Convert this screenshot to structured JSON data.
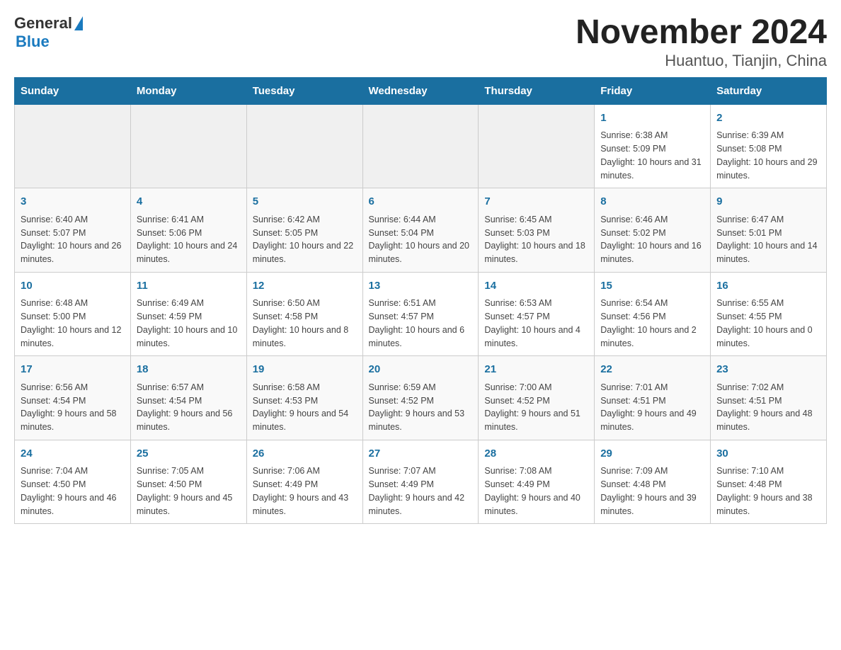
{
  "header": {
    "logo": {
      "text_general": "General",
      "triangle": "▶",
      "text_blue": "Blue"
    },
    "title": "November 2024",
    "subtitle": "Huantuo, Tianjin, China"
  },
  "days_of_week": [
    "Sunday",
    "Monday",
    "Tuesday",
    "Wednesday",
    "Thursday",
    "Friday",
    "Saturday"
  ],
  "weeks": [
    {
      "cells": [
        {
          "day": "",
          "info": ""
        },
        {
          "day": "",
          "info": ""
        },
        {
          "day": "",
          "info": ""
        },
        {
          "day": "",
          "info": ""
        },
        {
          "day": "",
          "info": ""
        },
        {
          "day": "1",
          "info": "Sunrise: 6:38 AM\nSunset: 5:09 PM\nDaylight: 10 hours and 31 minutes."
        },
        {
          "day": "2",
          "info": "Sunrise: 6:39 AM\nSunset: 5:08 PM\nDaylight: 10 hours and 29 minutes."
        }
      ]
    },
    {
      "cells": [
        {
          "day": "3",
          "info": "Sunrise: 6:40 AM\nSunset: 5:07 PM\nDaylight: 10 hours and 26 minutes."
        },
        {
          "day": "4",
          "info": "Sunrise: 6:41 AM\nSunset: 5:06 PM\nDaylight: 10 hours and 24 minutes."
        },
        {
          "day": "5",
          "info": "Sunrise: 6:42 AM\nSunset: 5:05 PM\nDaylight: 10 hours and 22 minutes."
        },
        {
          "day": "6",
          "info": "Sunrise: 6:44 AM\nSunset: 5:04 PM\nDaylight: 10 hours and 20 minutes."
        },
        {
          "day": "7",
          "info": "Sunrise: 6:45 AM\nSunset: 5:03 PM\nDaylight: 10 hours and 18 minutes."
        },
        {
          "day": "8",
          "info": "Sunrise: 6:46 AM\nSunset: 5:02 PM\nDaylight: 10 hours and 16 minutes."
        },
        {
          "day": "9",
          "info": "Sunrise: 6:47 AM\nSunset: 5:01 PM\nDaylight: 10 hours and 14 minutes."
        }
      ]
    },
    {
      "cells": [
        {
          "day": "10",
          "info": "Sunrise: 6:48 AM\nSunset: 5:00 PM\nDaylight: 10 hours and 12 minutes."
        },
        {
          "day": "11",
          "info": "Sunrise: 6:49 AM\nSunset: 4:59 PM\nDaylight: 10 hours and 10 minutes."
        },
        {
          "day": "12",
          "info": "Sunrise: 6:50 AM\nSunset: 4:58 PM\nDaylight: 10 hours and 8 minutes."
        },
        {
          "day": "13",
          "info": "Sunrise: 6:51 AM\nSunset: 4:57 PM\nDaylight: 10 hours and 6 minutes."
        },
        {
          "day": "14",
          "info": "Sunrise: 6:53 AM\nSunset: 4:57 PM\nDaylight: 10 hours and 4 minutes."
        },
        {
          "day": "15",
          "info": "Sunrise: 6:54 AM\nSunset: 4:56 PM\nDaylight: 10 hours and 2 minutes."
        },
        {
          "day": "16",
          "info": "Sunrise: 6:55 AM\nSunset: 4:55 PM\nDaylight: 10 hours and 0 minutes."
        }
      ]
    },
    {
      "cells": [
        {
          "day": "17",
          "info": "Sunrise: 6:56 AM\nSunset: 4:54 PM\nDaylight: 9 hours and 58 minutes."
        },
        {
          "day": "18",
          "info": "Sunrise: 6:57 AM\nSunset: 4:54 PM\nDaylight: 9 hours and 56 minutes."
        },
        {
          "day": "19",
          "info": "Sunrise: 6:58 AM\nSunset: 4:53 PM\nDaylight: 9 hours and 54 minutes."
        },
        {
          "day": "20",
          "info": "Sunrise: 6:59 AM\nSunset: 4:52 PM\nDaylight: 9 hours and 53 minutes."
        },
        {
          "day": "21",
          "info": "Sunrise: 7:00 AM\nSunset: 4:52 PM\nDaylight: 9 hours and 51 minutes."
        },
        {
          "day": "22",
          "info": "Sunrise: 7:01 AM\nSunset: 4:51 PM\nDaylight: 9 hours and 49 minutes."
        },
        {
          "day": "23",
          "info": "Sunrise: 7:02 AM\nSunset: 4:51 PM\nDaylight: 9 hours and 48 minutes."
        }
      ]
    },
    {
      "cells": [
        {
          "day": "24",
          "info": "Sunrise: 7:04 AM\nSunset: 4:50 PM\nDaylight: 9 hours and 46 minutes."
        },
        {
          "day": "25",
          "info": "Sunrise: 7:05 AM\nSunset: 4:50 PM\nDaylight: 9 hours and 45 minutes."
        },
        {
          "day": "26",
          "info": "Sunrise: 7:06 AM\nSunset: 4:49 PM\nDaylight: 9 hours and 43 minutes."
        },
        {
          "day": "27",
          "info": "Sunrise: 7:07 AM\nSunset: 4:49 PM\nDaylight: 9 hours and 42 minutes."
        },
        {
          "day": "28",
          "info": "Sunrise: 7:08 AM\nSunset: 4:49 PM\nDaylight: 9 hours and 40 minutes."
        },
        {
          "day": "29",
          "info": "Sunrise: 7:09 AM\nSunset: 4:48 PM\nDaylight: 9 hours and 39 minutes."
        },
        {
          "day": "30",
          "info": "Sunrise: 7:10 AM\nSunset: 4:48 PM\nDaylight: 9 hours and 38 minutes."
        }
      ]
    }
  ]
}
